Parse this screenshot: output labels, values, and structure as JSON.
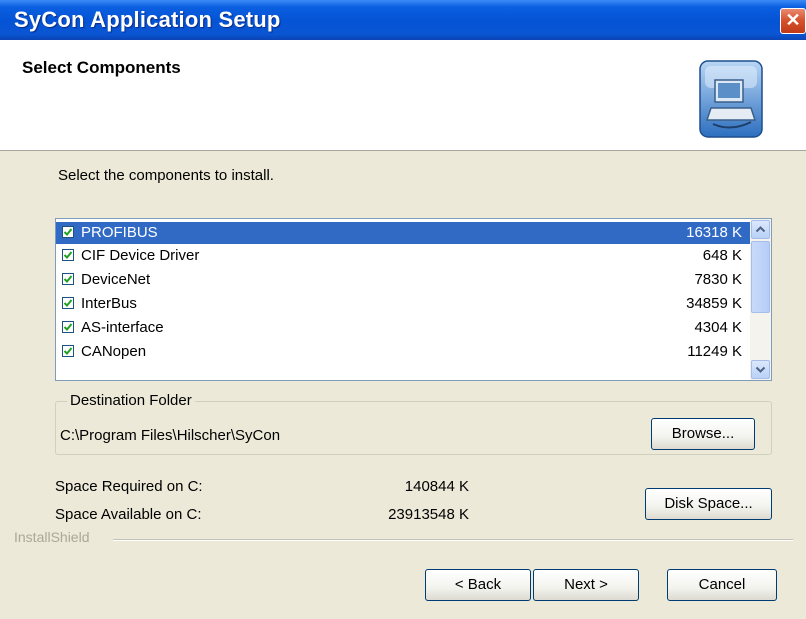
{
  "window": {
    "title": "SyCon Application Setup"
  },
  "header": {
    "title": "Select Components"
  },
  "instruction": "Select the components to install.",
  "components": [
    {
      "name": "PROFIBUS",
      "size": "16318 K",
      "checked": true,
      "selected": true
    },
    {
      "name": "CIF Device Driver",
      "size": "648 K",
      "checked": true,
      "selected": false
    },
    {
      "name": "DeviceNet",
      "size": "7830 K",
      "checked": true,
      "selected": false
    },
    {
      "name": "InterBus",
      "size": "34859 K",
      "checked": true,
      "selected": false
    },
    {
      "name": "AS-interface",
      "size": "4304 K",
      "checked": true,
      "selected": false
    },
    {
      "name": "CANopen",
      "size": "11249 K",
      "checked": true,
      "selected": false
    }
  ],
  "destination": {
    "label": "Destination Folder",
    "path": "C:\\Program Files\\Hilscher\\SyCon",
    "browse_label": "Browse..."
  },
  "space": {
    "required_label": "Space Required on C:",
    "required_value": "140844 K",
    "available_label": "Space Available on C:",
    "available_value": "23913548 K",
    "disk_space_label": "Disk Space..."
  },
  "installshield_label": "InstallShield",
  "buttons": {
    "back": "< Back",
    "next": "Next >",
    "cancel": "Cancel"
  },
  "colors": {
    "titlebar": "#0554d6",
    "selection": "#316ac5",
    "dialog_bg": "#ece9d8"
  }
}
